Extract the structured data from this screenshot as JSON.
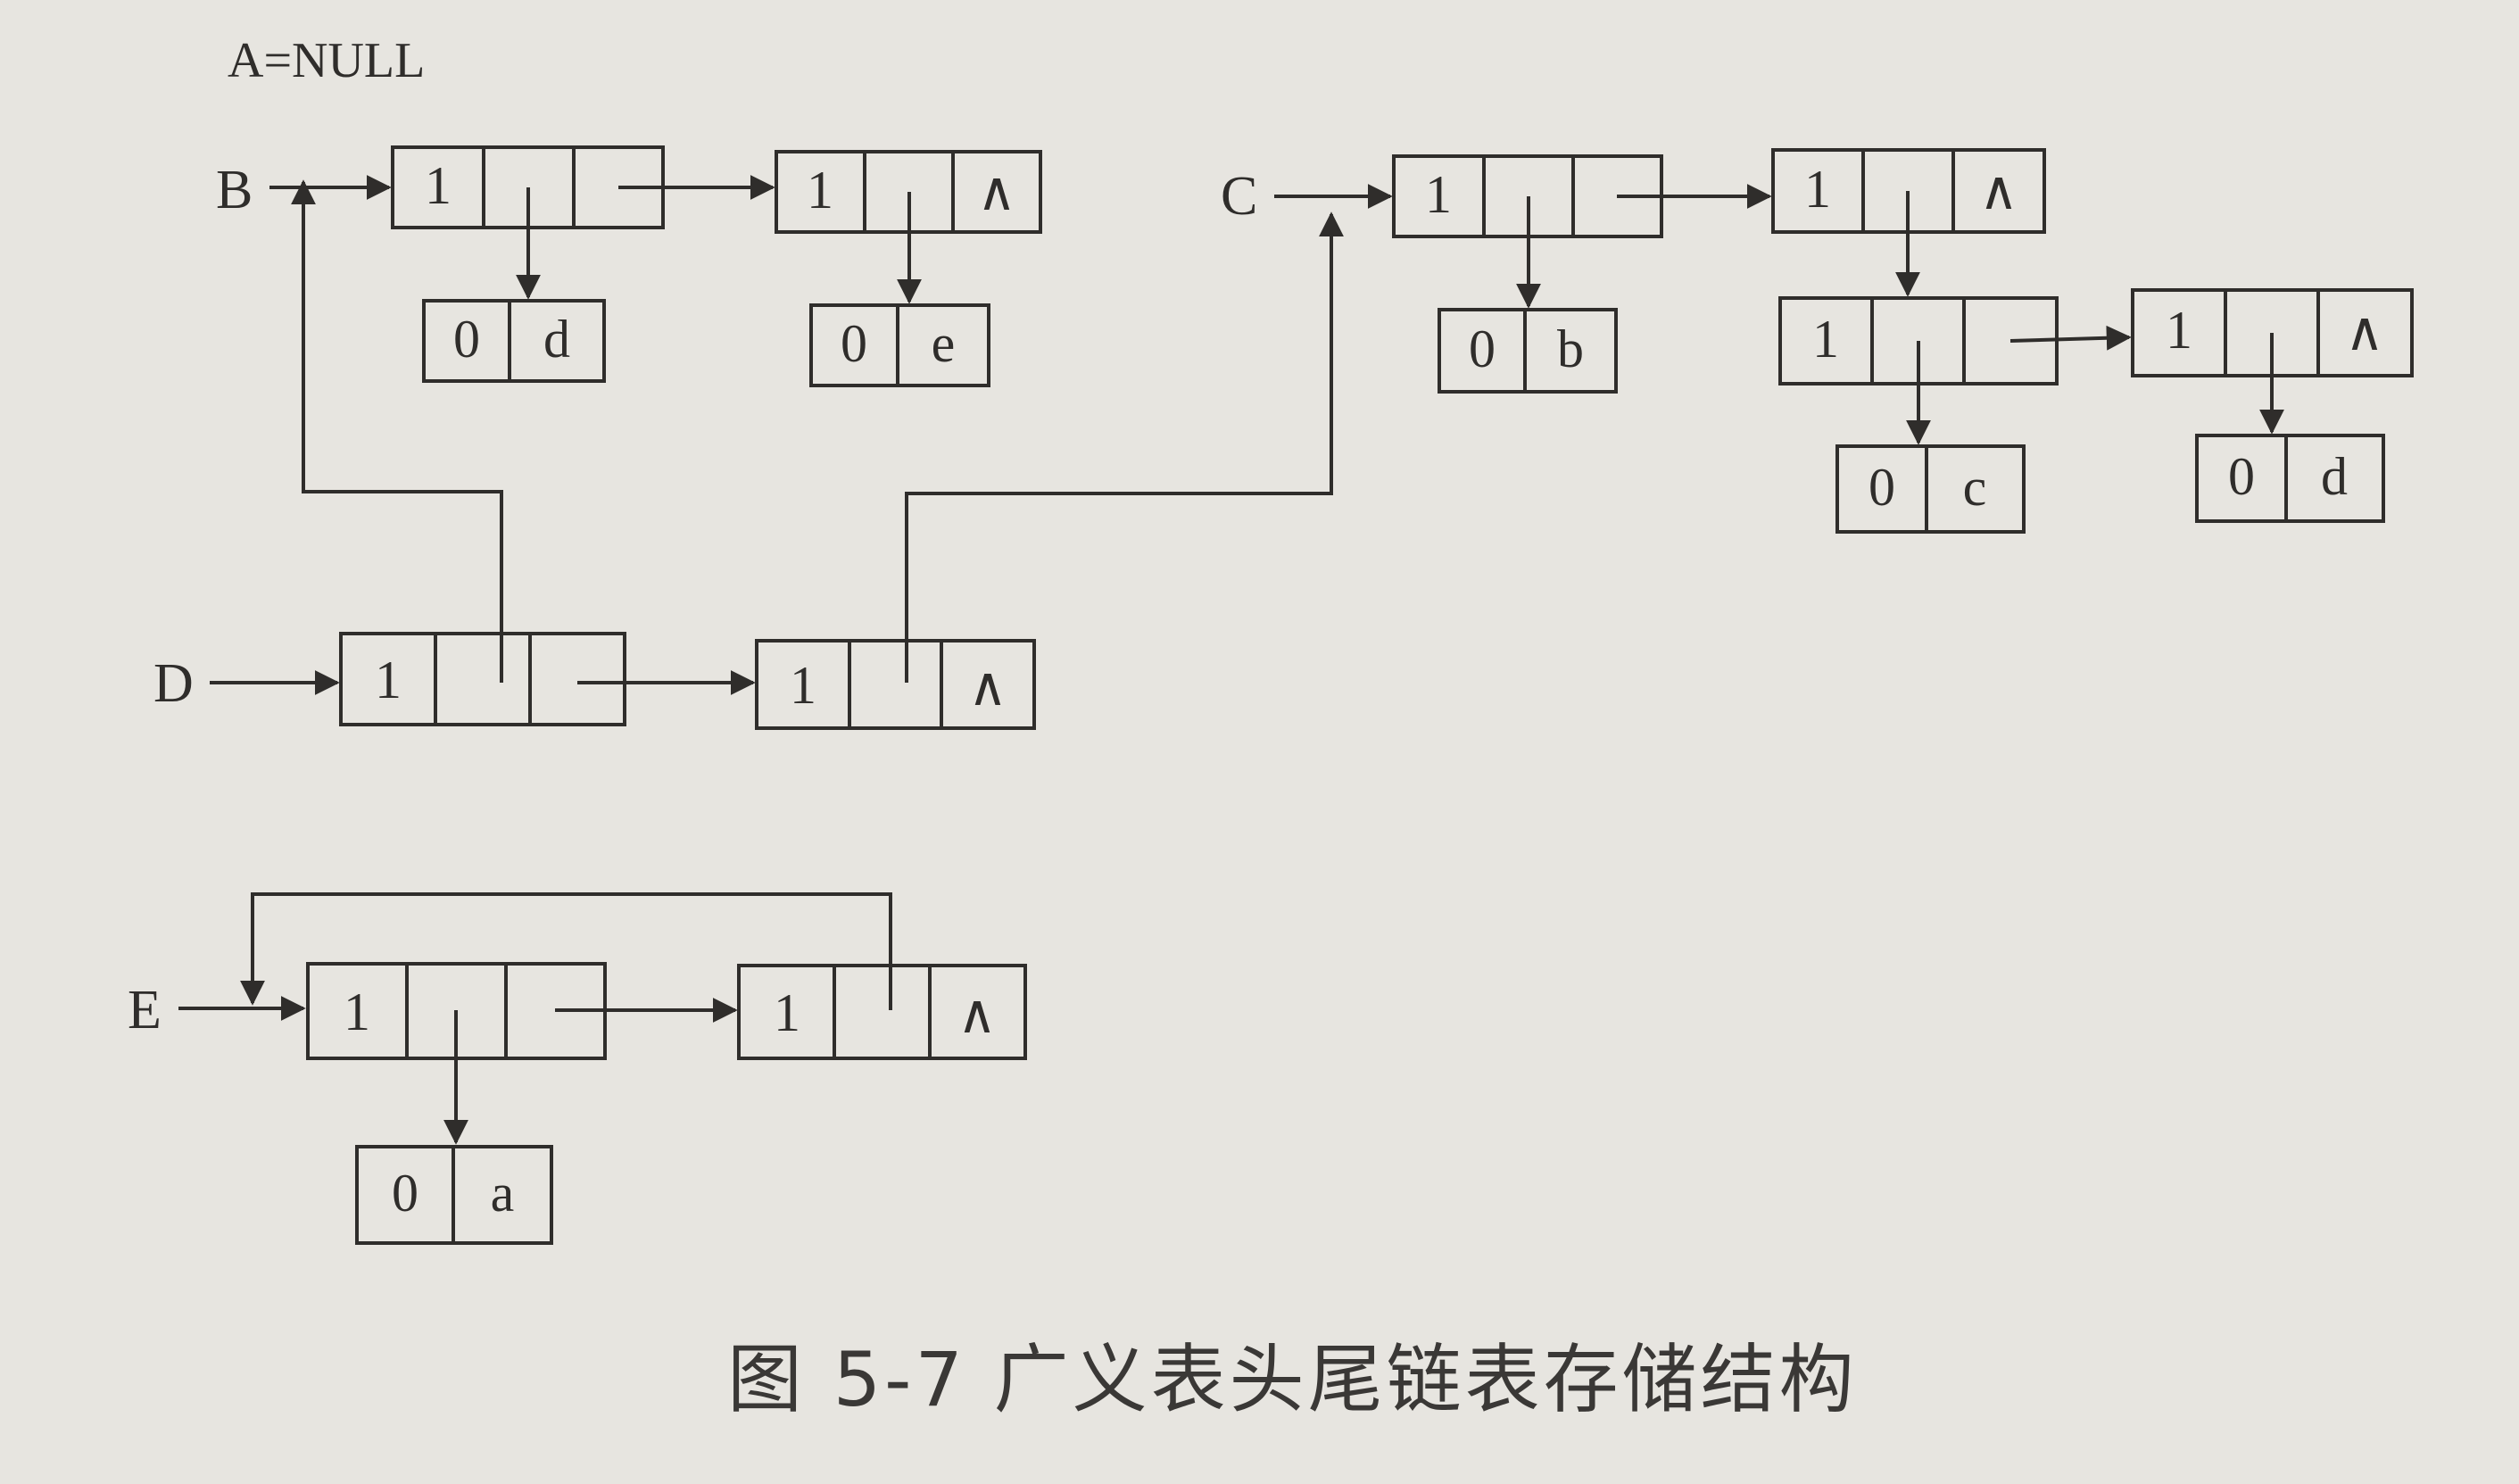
{
  "annotation": "A=NULL",
  "caption": "图 5-7   广义表头尾链表存储结构",
  "lists": {
    "B": {
      "label": "B",
      "node1": {
        "tag": "1"
      },
      "node2": {
        "tag": "1",
        "null_symbol": "∧"
      },
      "atom1": {
        "tag": "0",
        "value": "d"
      },
      "atom2": {
        "tag": "0",
        "value": "e"
      }
    },
    "C": {
      "label": "C",
      "node1": {
        "tag": "1"
      },
      "node2": {
        "tag": "1",
        "null_symbol": "∧"
      },
      "atom_b": {
        "tag": "0",
        "value": "b"
      },
      "sub_node1": {
        "tag": "1"
      },
      "sub_node2": {
        "tag": "1",
        "null_symbol": "∧"
      },
      "atom_c": {
        "tag": "0",
        "value": "c"
      },
      "atom_d": {
        "tag": "0",
        "value": "d"
      }
    },
    "D": {
      "label": "D",
      "node1": {
        "tag": "1"
      },
      "node2": {
        "tag": "1",
        "null_symbol": "∧"
      }
    },
    "E": {
      "label": "E",
      "node1": {
        "tag": "1"
      },
      "node2": {
        "tag": "1",
        "null_symbol": "∧"
      },
      "atom_a": {
        "tag": "0",
        "value": "a"
      }
    }
  }
}
